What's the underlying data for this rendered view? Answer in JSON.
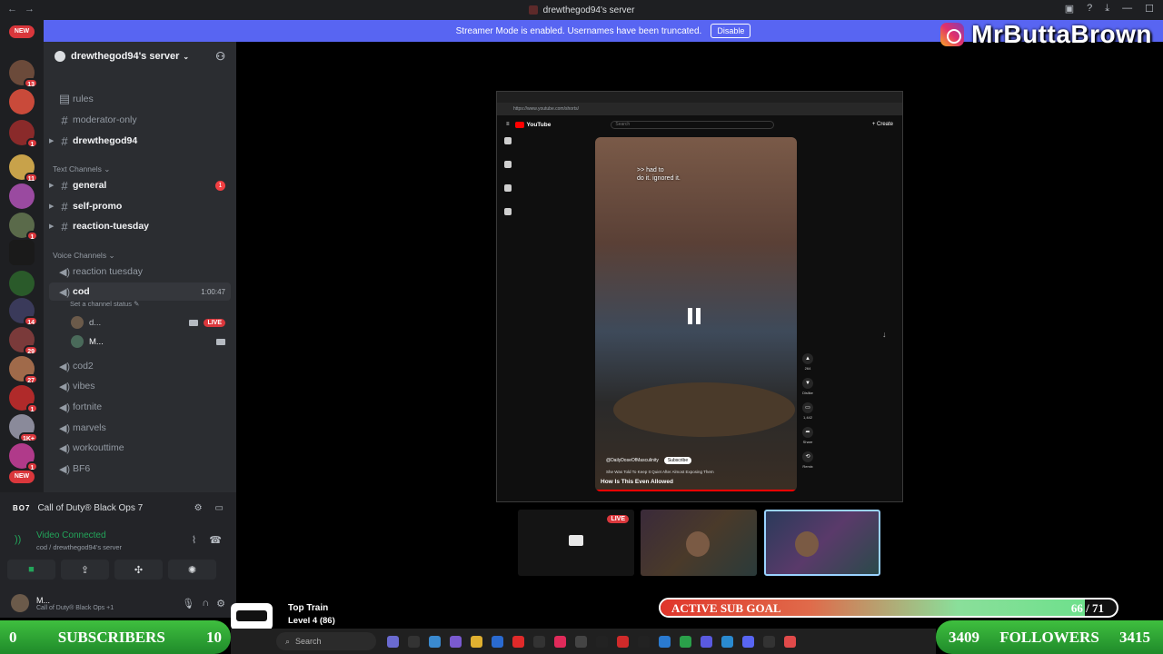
{
  "window": {
    "title": "drewthegod94's server"
  },
  "banner": {
    "text": "Streamer Mode is enabled. Usernames have been truncated.",
    "button": "Disable"
  },
  "watermark": {
    "name": "MrButtaBrown"
  },
  "rail": {
    "top_pill": "NEW",
    "bottom_pill": "NEW",
    "badges": [
      "13",
      "1",
      "11",
      "1",
      "14",
      "1",
      "29",
      "27",
      "1",
      "1K+",
      "1"
    ]
  },
  "server": {
    "name": "drewthegod94's server"
  },
  "channels": {
    "top": [
      "rules",
      "moderator-only",
      "drewthegod94"
    ],
    "text_category": "Text Channels",
    "text": [
      {
        "name": "general",
        "mentions": "1"
      },
      {
        "name": "self-promo"
      },
      {
        "name": "reaction-tuesday"
      }
    ],
    "voice_category": "Voice Channels",
    "voice": [
      "reaction tuesday",
      "cod",
      "cod2",
      "vibes",
      "fortnite",
      "marvels",
      "workouttime",
      "BF6"
    ],
    "cod_timer": "1:00:47",
    "cod_status": "Set a channel status",
    "voice_users": [
      {
        "name": "d...",
        "live": "LIVE"
      },
      {
        "name": "M..."
      }
    ]
  },
  "activity": {
    "logo": "BO7",
    "game": "Call of Duty® Black Ops 7"
  },
  "voice_panel": {
    "status": "Video Connected",
    "location": "cod / drewthegod94's server"
  },
  "user_panel": {
    "name": "M...",
    "status": "Call of Duty® Black Ops +1"
  },
  "browser": {
    "url": "https://www.youtube.com/shorts/",
    "logo": "YouTube",
    "search_placeholder": "Search",
    "create": "+ Create",
    "caption_line1": ">> had to",
    "caption_line2": "do it. ignored it.",
    "channel": "@DailyDoseOfMasculinity",
    "subscribe": "Subscribe",
    "subtitle": "She Was Told To Keep It Quiet After Almost Exposing Them",
    "short_title": "How Is This Even Allowed",
    "actions": [
      "264",
      "Dislike",
      "1,442",
      "Share",
      "Remix"
    ]
  },
  "previews": {
    "live_label": "LIVE"
  },
  "sub_goal": {
    "label": "ACTIVE SUB GOAL",
    "current": "66",
    "target": "71",
    "display": "66 / 71",
    "progress": 0.93
  },
  "subscribers": {
    "start": "0",
    "label": "SUBSCRIBERS",
    "goal": "10"
  },
  "followers": {
    "current": "3409",
    "label": "FOLLOWERS",
    "goal": "3415"
  },
  "top_train": {
    "title": "Top Train",
    "level": "Level 4  (86)"
  },
  "taskbar": {
    "search": "Search"
  },
  "colors": {
    "discord_blurple": "#5865f2",
    "live_red": "#da373c",
    "goal_green": "#3fbf3f"
  }
}
